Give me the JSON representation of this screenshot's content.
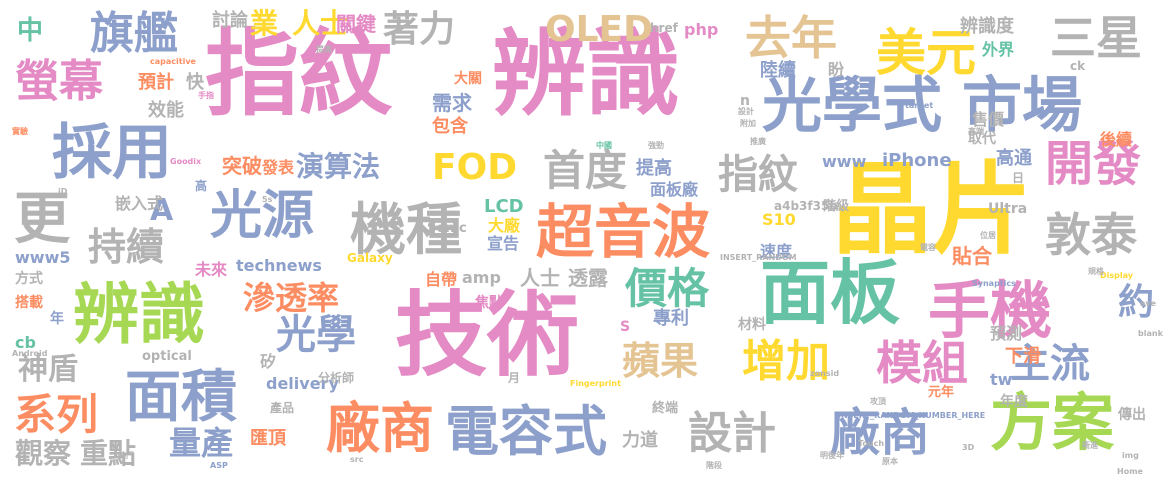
{
  "palette": {
    "pink": "#e48ac4",
    "blue": "#8da0cb",
    "green": "#66c2a5",
    "orange": "#fc8d62",
    "yellow": "#ffd92f",
    "lime": "#a6d854",
    "tan": "#e5c494",
    "gray": "#b3b3b3"
  },
  "words": [
    {
      "text": "指紋",
      "color": "pink"
    },
    {
      "text": "辨識",
      "color": "pink"
    },
    {
      "text": "技術",
      "color": "pink"
    },
    {
      "text": "晶片",
      "color": "yellow"
    },
    {
      "text": "光學式",
      "color": "blue"
    },
    {
      "text": "市場",
      "color": "blue"
    },
    {
      "text": "面板",
      "color": "green"
    },
    {
      "text": "辨識",
      "color": "lime"
    },
    {
      "text": "手機",
      "color": "pink"
    },
    {
      "text": "方案",
      "color": "lime"
    },
    {
      "text": "超音波",
      "color": "orange"
    },
    {
      "text": "電容式",
      "color": "blue"
    },
    {
      "text": "機種",
      "color": "gray"
    },
    {
      "text": "光源",
      "color": "blue"
    },
    {
      "text": "採用",
      "color": "blue"
    },
    {
      "text": "面積",
      "color": "blue"
    },
    {
      "text": "廠商",
      "color": "orange"
    },
    {
      "text": "廠商",
      "color": "blue"
    },
    {
      "text": "美元",
      "color": "yellow"
    },
    {
      "text": "去年",
      "color": "tan"
    },
    {
      "text": "螢幕",
      "color": "pink"
    },
    {
      "text": "旗艦",
      "color": "blue"
    },
    {
      "text": "三星",
      "color": "gray"
    },
    {
      "text": "OLED",
      "color": "tan"
    },
    {
      "text": "開發",
      "color": "pink"
    },
    {
      "text": "敦泰",
      "color": "gray"
    },
    {
      "text": "更",
      "color": "gray"
    },
    {
      "text": "模組",
      "color": "pink"
    },
    {
      "text": "增加",
      "color": "yellow"
    },
    {
      "text": "價格",
      "color": "green"
    },
    {
      "text": "設計",
      "color": "gray"
    },
    {
      "text": "主流",
      "color": "blue"
    },
    {
      "text": "系列",
      "color": "orange"
    },
    {
      "text": "FOD",
      "color": "yellow"
    },
    {
      "text": "首度",
      "color": "gray"
    },
    {
      "text": "指紋",
      "color": "gray"
    },
    {
      "text": "光學",
      "color": "blue"
    },
    {
      "text": "滲透率",
      "color": "orange"
    },
    {
      "text": "蘋果",
      "color": "tan"
    },
    {
      "text": "持續",
      "color": "gray"
    },
    {
      "text": "量產",
      "color": "blue"
    },
    {
      "text": "著力",
      "color": "gray"
    },
    {
      "text": "演算法",
      "color": "blue"
    },
    {
      "text": "神盾",
      "color": "gray"
    },
    {
      "text": "A",
      "color": "blue"
    },
    {
      "text": "約",
      "color": "blue"
    },
    {
      "text": "觀察",
      "color": "gray"
    },
    {
      "text": "重點",
      "color": "gray"
    },
    {
      "text": "業",
      "color": "yellow"
    },
    {
      "text": "人士",
      "color": "yellow"
    },
    {
      "text": "關鍵",
      "color": "pink"
    },
    {
      "text": "討論",
      "color": "gray"
    },
    {
      "text": "辨識度",
      "color": "gray"
    },
    {
      "text": "外界",
      "color": "green"
    },
    {
      "text": "中",
      "color": "green"
    },
    {
      "text": "預計",
      "color": "orange"
    },
    {
      "text": "快",
      "color": "gray"
    },
    {
      "text": "效能",
      "color": "gray"
    },
    {
      "text": "大關",
      "color": "orange"
    },
    {
      "text": "需求",
      "color": "blue"
    },
    {
      "text": "包含",
      "color": "orange"
    },
    {
      "text": "突破",
      "color": "orange"
    },
    {
      "text": "發表",
      "color": "orange"
    },
    {
      "text": "提高",
      "color": "blue"
    },
    {
      "text": "面板廠",
      "color": "blue"
    },
    {
      "text": "陸續",
      "color": "blue"
    },
    {
      "text": "盼",
      "color": "gray"
    },
    {
      "text": "售價",
      "color": "gray"
    },
    {
      "text": "高通",
      "color": "blue"
    },
    {
      "text": "後續",
      "color": "orange"
    },
    {
      "text": "取代",
      "color": "gray"
    },
    {
      "text": "www",
      "color": "blue"
    },
    {
      "text": "iPhone",
      "color": "blue"
    },
    {
      "text": "嵌入式",
      "color": "gray"
    },
    {
      "text": "大廠",
      "color": "yellow"
    },
    {
      "text": "宣告",
      "color": "blue"
    },
    {
      "text": "LCD",
      "color": "green"
    },
    {
      "text": "Sonic",
      "color": "gray"
    },
    {
      "text": "S10",
      "color": "yellow"
    },
    {
      "text": "速度",
      "color": "blue"
    },
    {
      "text": "貼合",
      "color": "orange"
    },
    {
      "text": "Ultra",
      "color": "gray"
    },
    {
      "text": "階級",
      "color": "gray"
    },
    {
      "text": "a4b3f35b",
      "color": "gray"
    },
    {
      "text": "Galaxy",
      "color": "yellow"
    },
    {
      "text": "www5",
      "color": "blue"
    },
    {
      "text": "未來",
      "color": "pink"
    },
    {
      "text": "technews",
      "color": "blue"
    },
    {
      "text": "方式",
      "color": "gray"
    },
    {
      "text": "搭載",
      "color": "orange"
    },
    {
      "text": "amp",
      "color": "gray"
    },
    {
      "text": "人士",
      "color": "gray"
    },
    {
      "text": "透露",
      "color": "gray"
    },
    {
      "text": "自帶",
      "color": "orange"
    },
    {
      "text": "焦點",
      "color": "pink"
    },
    {
      "text": "專利",
      "color": "blue"
    },
    {
      "text": "材料",
      "color": "gray"
    },
    {
      "text": "預測",
      "color": "gray"
    },
    {
      "text": "下滑",
      "color": "orange"
    },
    {
      "text": "tw",
      "color": "blue"
    },
    {
      "text": "年度",
      "color": "gray"
    },
    {
      "text": "元年",
      "color": "orange"
    },
    {
      "text": "delivery",
      "color": "blue"
    },
    {
      "text": "分析師",
      "color": "gray"
    },
    {
      "text": "optical",
      "color": "gray"
    },
    {
      "text": "產品",
      "color": "gray"
    },
    {
      "text": "匯頂",
      "color": "orange"
    },
    {
      "text": "力道",
      "color": "gray"
    },
    {
      "text": "終端",
      "color": "gray"
    },
    {
      "text": "cb",
      "color": "green"
    },
    {
      "text": "年",
      "color": "blue"
    },
    {
      "text": "矽",
      "color": "gray"
    },
    {
      "text": "月",
      "color": "gray"
    },
    {
      "text": "S",
      "color": "pink"
    },
    {
      "text": "php",
      "color": "pink"
    },
    {
      "text": "href",
      "color": "gray"
    },
    {
      "text": "ck",
      "color": "gray"
    },
    {
      "text": "n",
      "color": "gray"
    },
    {
      "text": "高",
      "color": "blue"
    },
    {
      "text": "日",
      "color": "gray"
    },
    {
      "text": "傳出",
      "color": "gray"
    },
    {
      "text": "設計",
      "color": "gray"
    },
    {
      "text": "附加",
      "color": "gray"
    },
    {
      "text": "capacitive",
      "color": "orange"
    },
    {
      "text": "INSERT_RANDOM",
      "color": "gray"
    },
    {
      "text": "INSERT_RANDOM_NUMBER_HERE",
      "color": "blue"
    },
    {
      "text": "Synaptics",
      "color": "blue"
    },
    {
      "text": "Fingerprint",
      "color": "yellow"
    },
    {
      "text": "Display",
      "color": "yellow"
    },
    {
      "text": "zonsid",
      "color": "gray"
    },
    {
      "text": "Touch",
      "color": "gray"
    },
    {
      "text": "blank",
      "color": "gray"
    },
    {
      "text": "ASP",
      "color": "blue"
    },
    {
      "text": "Android",
      "color": "gray"
    },
    {
      "text": "Goodix",
      "color": "pink"
    },
    {
      "text": "src",
      "color": "gray"
    },
    {
      "text": "img",
      "color": "gray"
    },
    {
      "text": "Home",
      "color": "gray"
    },
    {
      "text": "3D",
      "color": "gray"
    },
    {
      "text": "5s",
      "color": "gray"
    },
    {
      "text": "iD",
      "color": "gray"
    },
    {
      "text": "ave",
      "color": "gray"
    },
    {
      "text": "target",
      "color": "blue"
    },
    {
      "text": "中國",
      "color": "green"
    },
    {
      "text": "手指",
      "color": "pink"
    },
    {
      "text": "實驗",
      "color": "orange"
    },
    {
      "text": "提高",
      "color": "gray"
    },
    {
      "text": "攻頂",
      "color": "gray"
    },
    {
      "text": "電容",
      "color": "gray"
    },
    {
      "text": "明後年",
      "color": "gray"
    },
    {
      "text": "原本",
      "color": "gray"
    },
    {
      "text": "衝進",
      "color": "gray"
    },
    {
      "text": "高端",
      "color": "gray"
    },
    {
      "text": "位居",
      "color": "gray"
    },
    {
      "text": "階段",
      "color": "gray"
    },
    {
      "text": "強勁",
      "color": "gray"
    },
    {
      "text": "規格",
      "color": "gray"
    },
    {
      "text": "推廣",
      "color": "gray"
    },
    {
      "text": "熱門",
      "color": "gray"
    },
    {
      "text": "進一步",
      "color": "gray"
    }
  ]
}
